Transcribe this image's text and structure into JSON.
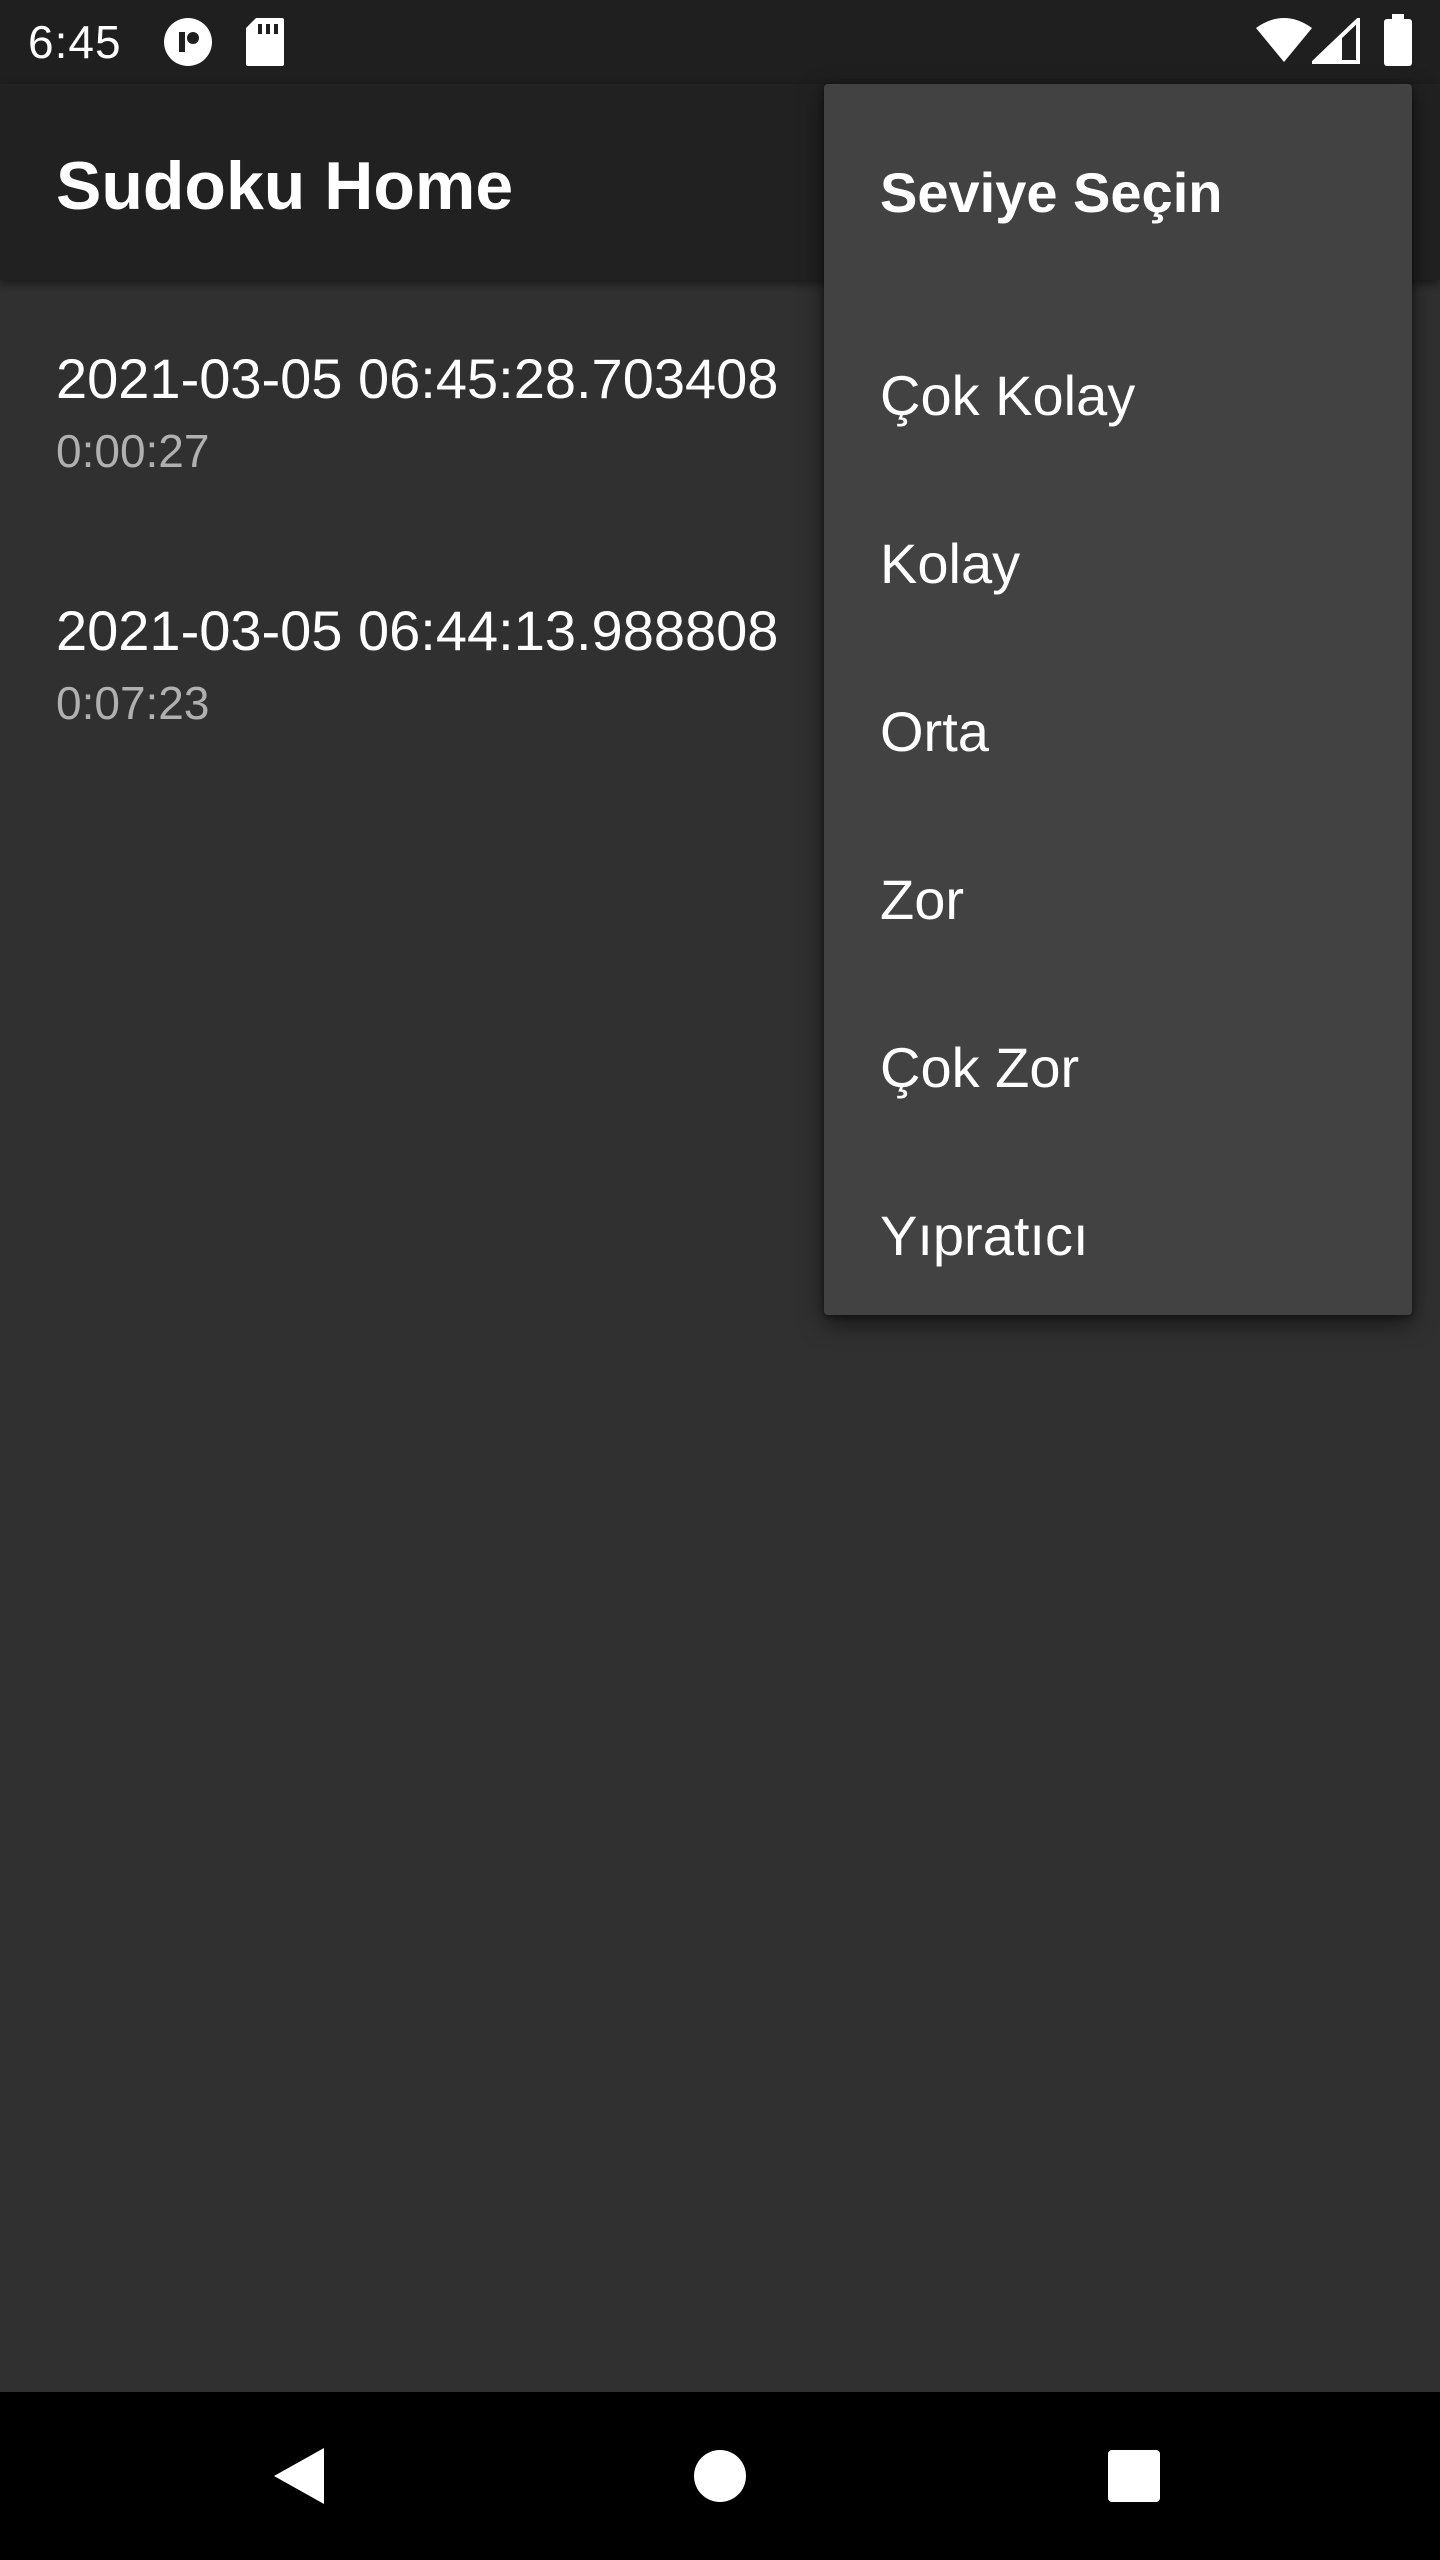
{
  "status_bar": {
    "time": "6:45",
    "icons": [
      "notification-app-icon",
      "sd-card-icon",
      "wifi-icon",
      "cell-signal-icon",
      "battery-icon"
    ]
  },
  "app_bar": {
    "title": "Sudoku Home"
  },
  "history": {
    "items": [
      {
        "timestamp": "2021-03-05 06:45:28.703408",
        "duration": "0:00:27"
      },
      {
        "timestamp": "2021-03-05 06:44:13.988808",
        "duration": "0:07:23"
      }
    ]
  },
  "menu": {
    "header": "Seviye Seçin",
    "items": [
      {
        "label": "Çok Kolay"
      },
      {
        "label": "Kolay"
      },
      {
        "label": "Orta"
      },
      {
        "label": "Zor"
      },
      {
        "label": "Çok Zor"
      },
      {
        "label": "Yıpratıcı"
      }
    ]
  },
  "nav_bar": {
    "icons": [
      "back-icon",
      "home-icon",
      "recents-icon"
    ]
  },
  "colors": {
    "background": "#303030",
    "app_bar": "#212121",
    "status_bar": "#1f1f1f",
    "menu": "#424242",
    "secondary_text": "#b0b0b0"
  }
}
